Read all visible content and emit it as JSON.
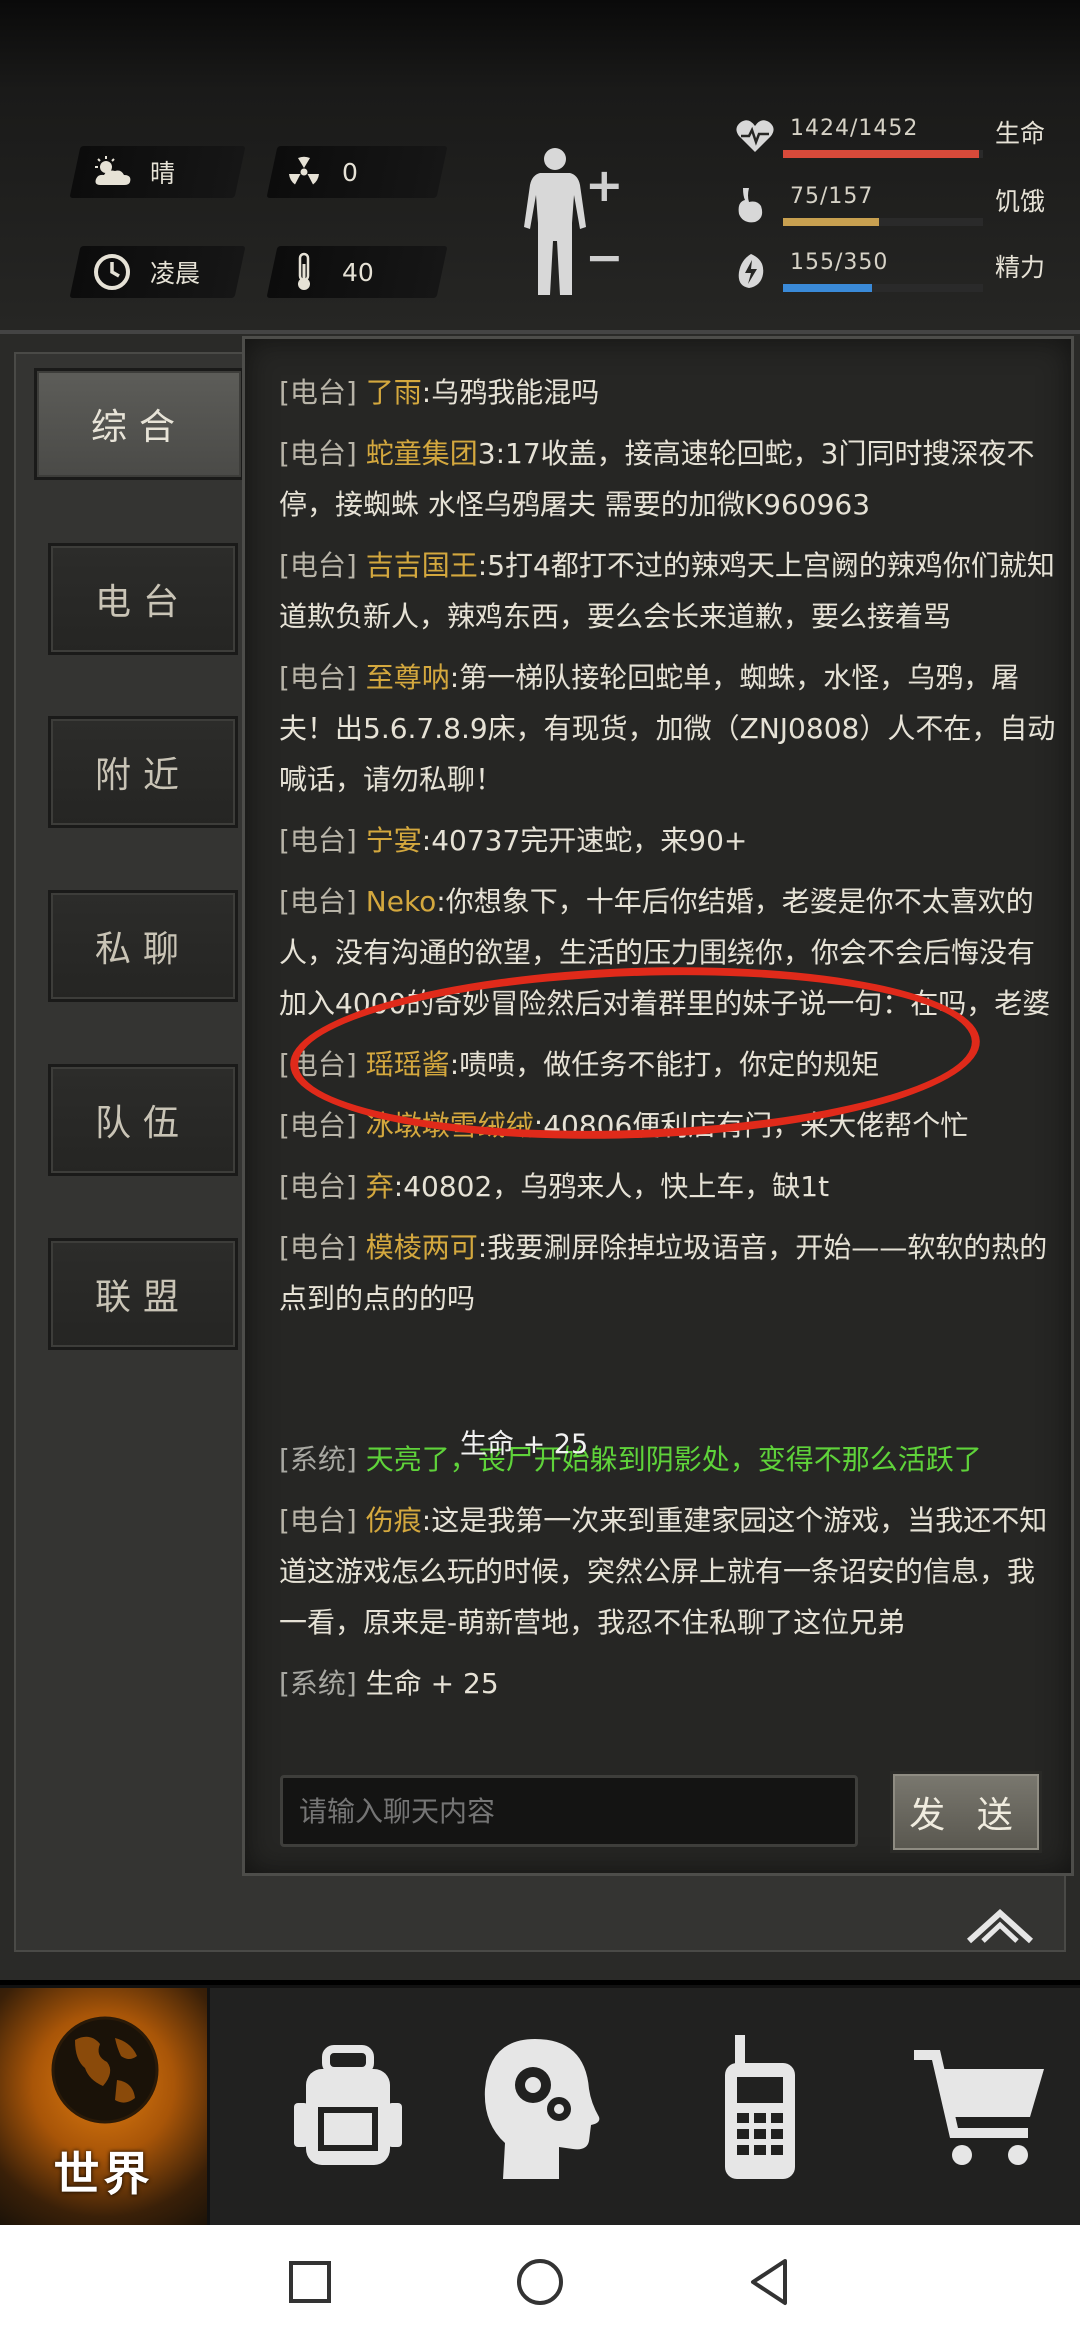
{
  "status": {
    "weather": "晴",
    "radiation": "0",
    "time_of_day": "凌晨",
    "temperature": "40"
  },
  "vitals": [
    {
      "value": "1424/1452",
      "label": "生命",
      "fraction": 0.979,
      "color": "#d84a3a",
      "icon": "heart-icon"
    },
    {
      "value": "75/157",
      "label": "饥饿",
      "fraction": 0.478,
      "color": "#c8a050",
      "icon": "stomach-icon"
    },
    {
      "value": "155/350",
      "label": "精力",
      "fraction": 0.443,
      "color": "#3a8ad8",
      "icon": "energy-icon"
    }
  ],
  "tabs": [
    {
      "label": "综合",
      "active": true
    },
    {
      "label": "电台",
      "active": false
    },
    {
      "label": "附近",
      "active": false
    },
    {
      "label": "私聊",
      "active": false
    },
    {
      "label": "队伍",
      "active": false
    },
    {
      "label": "联盟",
      "active": false
    }
  ],
  "messages": [
    {
      "channel": "[电台]",
      "user": "了雨",
      "text": ":乌鸦我能混吗"
    },
    {
      "channel": "[电台]",
      "user": "蛇童集团",
      "text": "3:17收盖，接高速轮回蛇，3门同时搜深夜不停，接蜘蛛 水怪乌鸦屠夫 需要的加微K960963"
    },
    {
      "channel": "[电台]",
      "user": "吉吉国王",
      "text": ":5打4都打不过的辣鸡天上宫阙的辣鸡你们就知道欺负新人，辣鸡东西，要么会长来道歉，要么接着骂"
    },
    {
      "channel": "[电台]",
      "user": "至尊呐",
      "text": ":第一梯队接轮回蛇单，蜘蛛，水怪，乌鸦，屠夫！出5.6.7.8.9床，有现货，加微（ZNJ0808）人不在，自动喊话，请勿私聊！"
    },
    {
      "channel": "[电台]",
      "user": "宁宴",
      "text": ":40737完开速蛇，来90+"
    },
    {
      "channel": "[电台]",
      "user": "Neko",
      "text": ":你想象下，十年后你结婚，老婆是你不太喜欢的人，没有沟通的欲望，生活的压力围绕你，你会不会后悔没有加入4000的奇妙冒险然后对着群里的妹子说一句：在吗，老婆"
    },
    {
      "channel": "[电台]",
      "user": "瑶瑶酱",
      "text": ":啧啧，做任务不能打，你定的规矩"
    },
    {
      "channel": "[电台]",
      "user": "冰墩墩雪绒绒",
      "text": ":40806便利店有门，来大佬帮个忙"
    },
    {
      "channel": "[电台]",
      "user": "弃",
      "text": ":40802，乌鸦来人，快上车，缺1t"
    },
    {
      "channel": "[电台]",
      "user": "模棱两可",
      "text": ":我要涮屏除掉垃圾语音，开始——软软的热的点到的点的的吗"
    },
    {
      "channel": "[系统]",
      "user": "",
      "text": "天亮了，丧尸开始躲到阴影处，变得不那么活跃了",
      "green": true
    },
    {
      "channel": "[电台]",
      "user": "伤痕",
      "text": ":这是我第一次来到重建家园这个游戏，当我还不知道这游戏怎么玩的时候，突然公屏上就有一条诏安的信息，我一看，原来是-萌新营地，我忍不住私聊了这位兄弟"
    },
    {
      "channel": "[系统]",
      "user": "",
      "text": "生命 + 25"
    }
  ],
  "floating_text": "生命 + 25",
  "input": {
    "placeholder": "请输入聊天内容"
  },
  "send_label": "发 送",
  "nav": {
    "world_label": "世界"
  }
}
